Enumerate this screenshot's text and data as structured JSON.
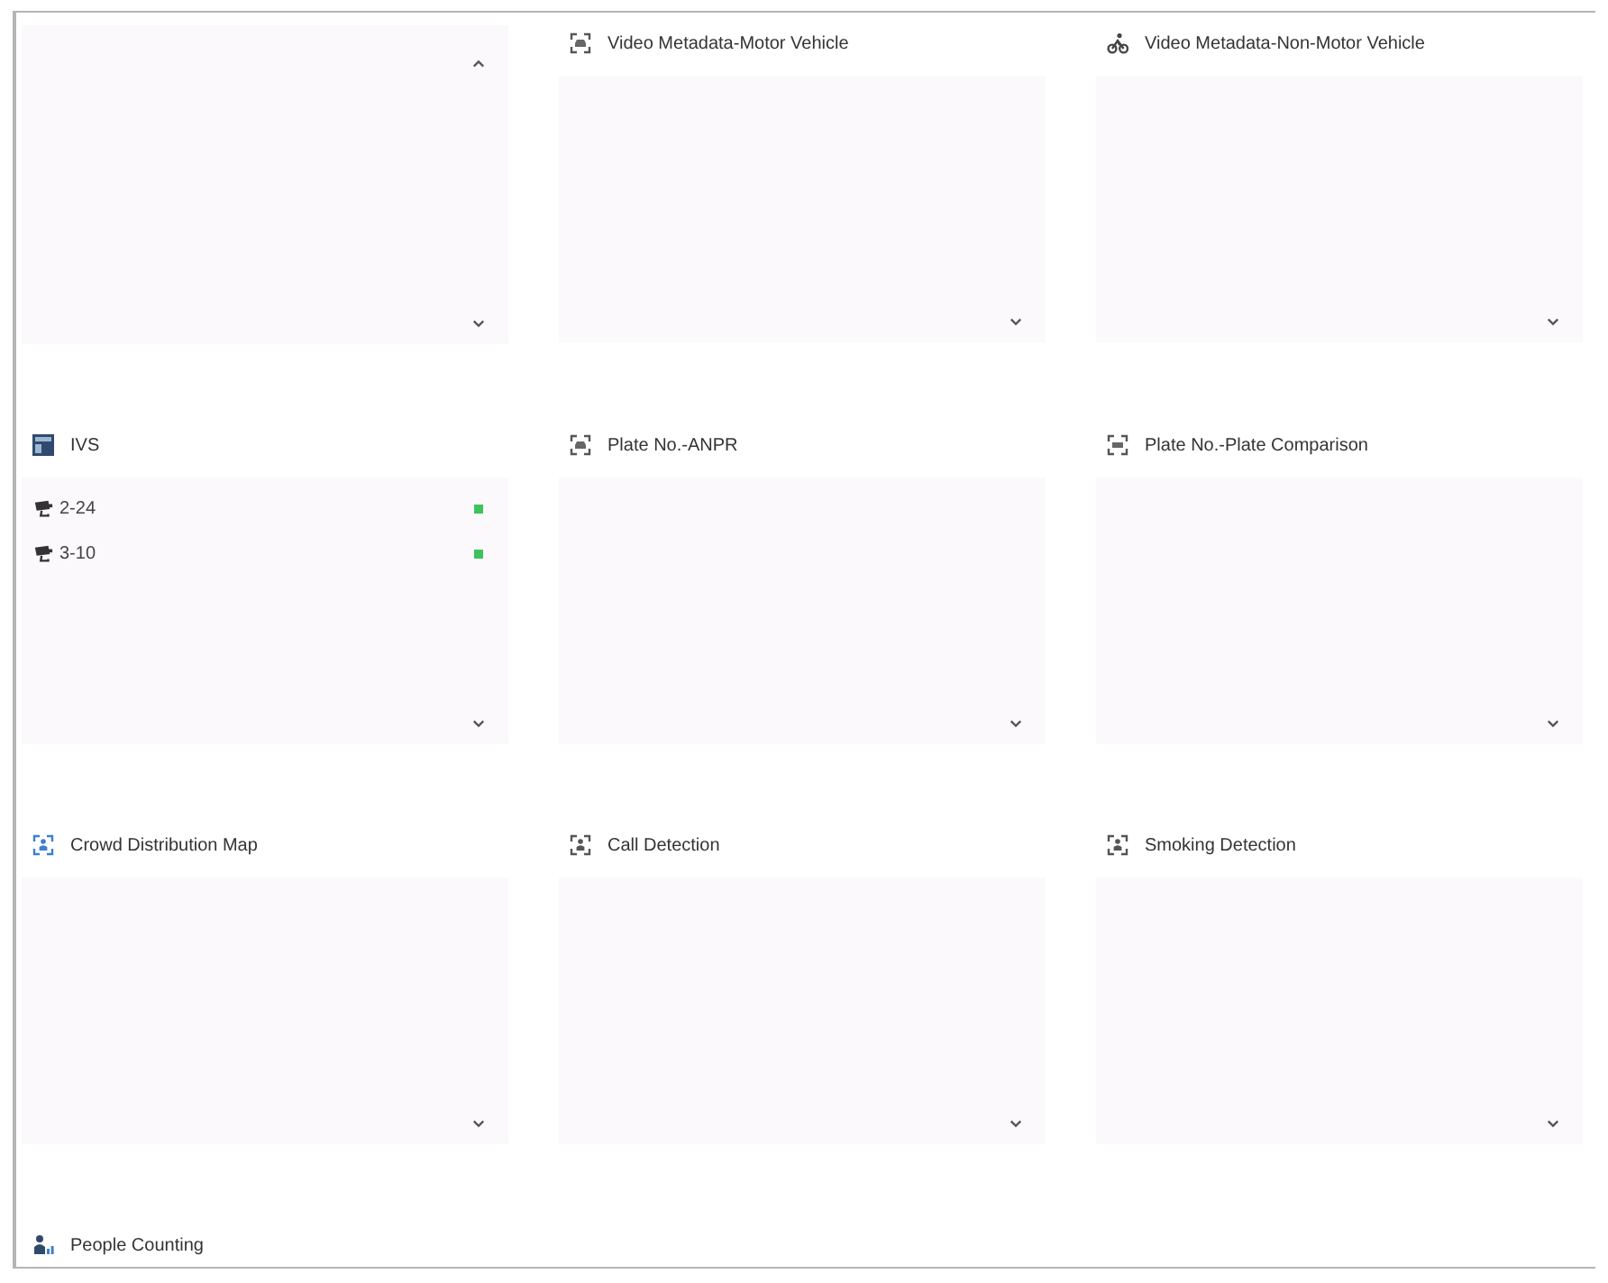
{
  "panels": [
    {
      "kind": "scrolled"
    },
    {
      "kind": "titled",
      "title": "Video Metadata-Motor Vehicle"
    },
    {
      "kind": "titled",
      "title": "Video Metadata-Non-Motor Vehicle"
    },
    {
      "kind": "titled",
      "title": "IVS",
      "items": [
        {
          "label": "2-24",
          "color": "#3cc35b"
        },
        {
          "label": "3-10",
          "color": "#3cc35b"
        }
      ]
    },
    {
      "kind": "titled",
      "title": "Plate No.-ANPR"
    },
    {
      "kind": "titled",
      "title": "Plate No.-Plate Comparison"
    },
    {
      "kind": "titled",
      "title": "Crowd Distribution Map"
    },
    {
      "kind": "titled",
      "title": "Call Detection"
    },
    {
      "kind": "titled",
      "title": "Smoking Detection"
    },
    {
      "kind": "header_only",
      "title": "People Counting"
    }
  ]
}
